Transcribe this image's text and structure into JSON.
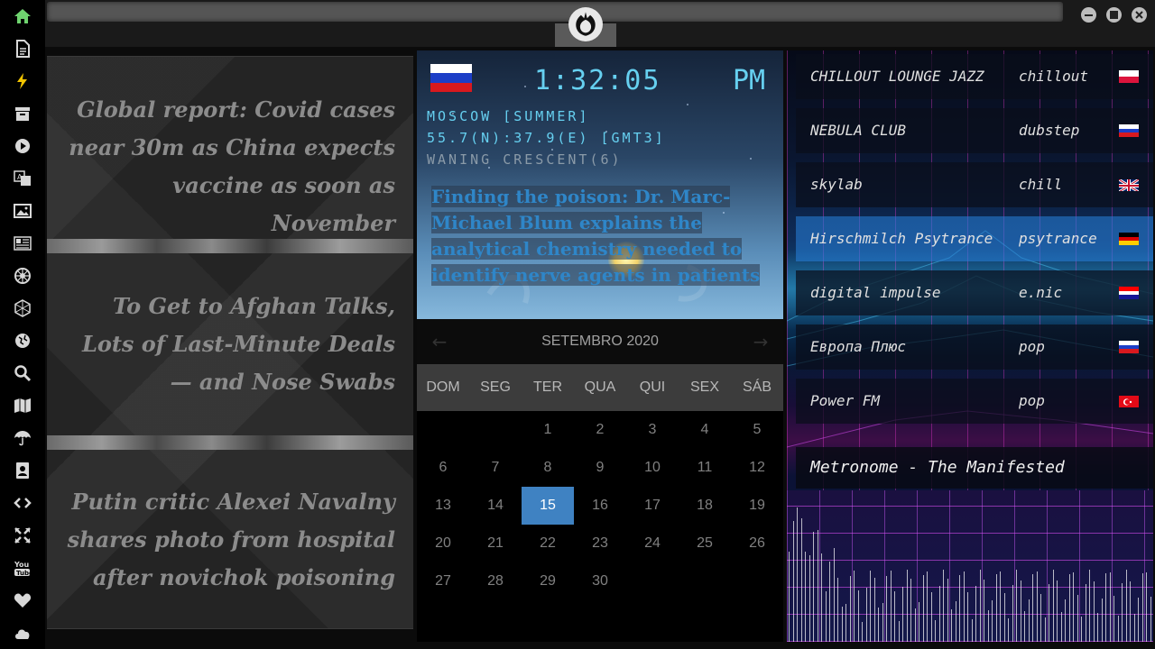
{
  "sidebar": {
    "icons": [
      {
        "name": "home-icon",
        "color": "#6fd36f"
      },
      {
        "name": "document-icon",
        "color": "#d8d8d8"
      },
      {
        "name": "lightning-icon",
        "color": "#f2c400"
      },
      {
        "name": "archive-icon",
        "color": "#d8d8d8"
      },
      {
        "name": "play-icon",
        "color": "#d8d8d8"
      },
      {
        "name": "translate-icon",
        "color": "#d8d8d8"
      },
      {
        "name": "image-icon",
        "color": "#d8d8d8"
      },
      {
        "name": "newspaper-icon",
        "color": "#d8d8d8"
      },
      {
        "name": "rebel-icon",
        "color": "#d8d8d8"
      },
      {
        "name": "hexagon-icon",
        "color": "#d8d8d8"
      },
      {
        "name": "globe-icon",
        "color": "#d8d8d8"
      },
      {
        "name": "search-icon",
        "color": "#d8d8d8"
      },
      {
        "name": "map-icon",
        "color": "#d8d8d8"
      },
      {
        "name": "umbrella-icon",
        "color": "#d8d8d8"
      },
      {
        "name": "contacts-icon",
        "color": "#d8d8d8"
      },
      {
        "name": "code-icon",
        "color": "#d8d8d8"
      },
      {
        "name": "expand-icon",
        "color": "#d8d8d8"
      },
      {
        "name": "youtube-icon",
        "color": "#d8d8d8"
      },
      {
        "name": "heart-icon",
        "color": "#d8d8d8"
      },
      {
        "name": "cloud-icon",
        "color": "#d8d8d8"
      }
    ]
  },
  "window": {
    "logo": "rebel-alliance-logo",
    "controls": [
      "minimize-icon",
      "maximize-icon",
      "close-icon"
    ]
  },
  "news": {
    "items": [
      "Global report: Covid cases near 30m as China expects vaccine as soon as November",
      "To Get to Afghan Talks, Lots of Last-Minute Deals — and Nose Swabs",
      "Putin critic Alexei Navalny shares photo from hospital after novichok poisoning"
    ]
  },
  "clock": {
    "time": "1:32:05",
    "ampm": "PM",
    "location": "MOSCOW [SUMMER]",
    "coords": "55.7(N):37.9(E) [GMT3]",
    "moon_phase": "WANING CRESCENT(6)",
    "article": "Finding the poison: Dr. Marc-Michael Blum explains the analytical chemistry needed to identify nerve agents in patients",
    "colors": {
      "accent": "#66d0f0",
      "location": "#f0c040",
      "muted": "#8a9aa8"
    }
  },
  "calendar": {
    "month": "SETEMBRO 2020",
    "weekdays": [
      "DOM",
      "SEG",
      "TER",
      "QUA",
      "QUI",
      "SEX",
      "SÁB"
    ],
    "days": [
      "1",
      "2",
      "3",
      "4",
      "5",
      "6",
      "7",
      "8",
      "9",
      "10",
      "11",
      "12",
      "13",
      "14",
      "15",
      "16",
      "17",
      "18",
      "19",
      "20",
      "21",
      "22",
      "23",
      "24",
      "25",
      "26",
      "27",
      "28",
      "29",
      "30"
    ],
    "first_weekday": 2,
    "today": "15"
  },
  "radio": {
    "stations": [
      {
        "name": "CHILLOUT LOUNGE JAZZ",
        "genre": "chillout",
        "flag": "pl"
      },
      {
        "name": "NEBULA CLUB",
        "genre": "dubstep",
        "flag": "ru"
      },
      {
        "name": "skylab",
        "genre": "chill",
        "flag": "uk"
      },
      {
        "name": "Hirschmilch Psytrance",
        "genre": "psytrance",
        "flag": "de",
        "active": true
      },
      {
        "name": "digital impulse",
        "genre": "e.nic",
        "flag": "hr"
      },
      {
        "name": "Европа Плюс",
        "genre": "pop",
        "flag": "ru"
      },
      {
        "name": "Power FM",
        "genre": "pop",
        "flag": "tr"
      }
    ],
    "now_playing": "Metronome - The Manifested"
  }
}
